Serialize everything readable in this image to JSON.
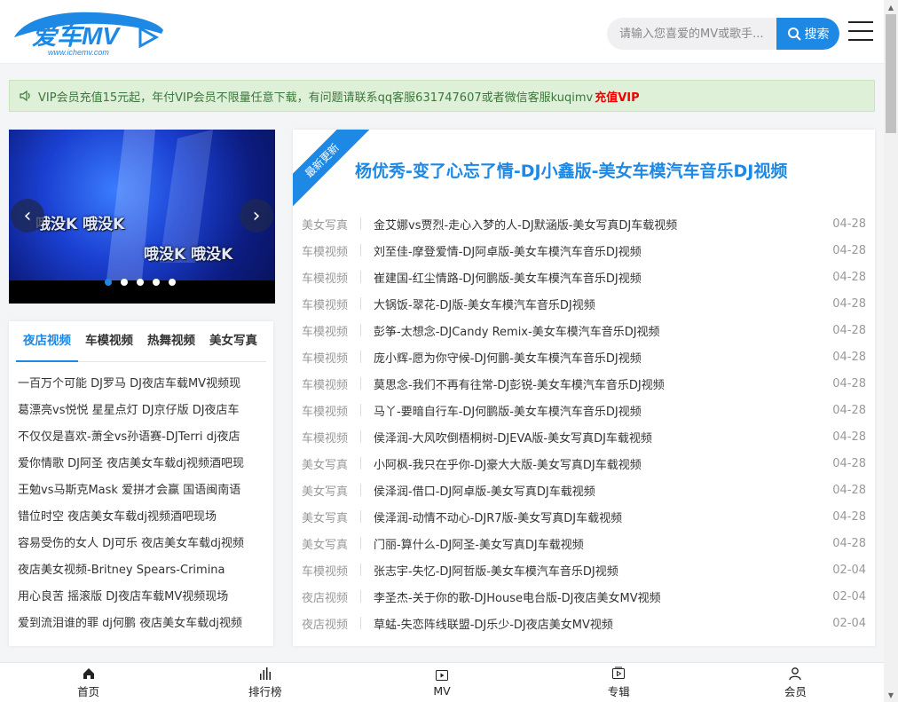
{
  "header": {
    "logo_text": "爱车MV",
    "logo_domain": "www.ichemv.com",
    "search_placeholder": "请输入您喜爱的MV或歌手...",
    "search_button": "搜索"
  },
  "notice": {
    "text": "VIP会员充值15元起，年付VIP会员不限量任意下载，有问题请联系qq客服631747607或者微信客服kuqimv",
    "link": "充值VIP"
  },
  "carousel": {
    "caption_1": "哦没K 哦没K",
    "caption_2": "哦没K 哦没K",
    "prev": "‹",
    "next": "›",
    "slide_count": 5,
    "active_slide": 1
  },
  "left_panel": {
    "tabs": [
      {
        "label": "夜店视频",
        "active": true
      },
      {
        "label": "车模视频",
        "active": false
      },
      {
        "label": "热舞视频",
        "active": false
      },
      {
        "label": "美女写真",
        "active": false
      }
    ],
    "items": [
      "一百万个可能 DJ罗马 DJ夜店车载MV视频现",
      "葛漂亮vs悦悦 星星点灯 DJ京仔版 DJ夜店车",
      "不仅仅是喜欢-萧全vs孙语赛-DJTerri dj夜店",
      "爱你情歌 DJ阿圣 夜店美女车载dj视频酒吧现",
      "王勉vs马斯克Mask 爱拼才会赢 国语闽南语",
      "错位时空 夜店美女车载dj视频酒吧现场",
      "容易受伤的女人 DJ可乐 夜店美女车载dj视频",
      "夜店美女视频-Britney Spears-Crimina",
      "用心良苦 摇滚版 DJ夜店车载MV视频现场",
      "爱到流泪谁的罪 dj何鹏 夜店美女车载dj视频"
    ]
  },
  "right_panel": {
    "ribbon": "最新更新",
    "featured_title": "杨优秀-变了心忘了情-DJ小鑫版-美女车模汽车音乐DJ视频",
    "rows": [
      {
        "cat": "美女写真",
        "title": "金艾娜vs贾烈-走心入梦的人-DJ默涵版-美女写真DJ车载视频",
        "date": "04-28"
      },
      {
        "cat": "车模视频",
        "title": "刘至佳-摩登爱情-DJ阿卓版-美女车模汽车音乐DJ视频",
        "date": "04-28"
      },
      {
        "cat": "车模视频",
        "title": "崔建国-红尘情路-DJ何鹏版-美女车模汽车音乐DJ视频",
        "date": "04-28"
      },
      {
        "cat": "车模视频",
        "title": "大锅饭-翠花-DJ版-美女车模汽车音乐DJ视频",
        "date": "04-28"
      },
      {
        "cat": "车模视频",
        "title": "彭筝-太想念-DJCandy Remix-美女车模汽车音乐DJ视频",
        "date": "04-28"
      },
      {
        "cat": "车模视频",
        "title": "庞小辉-愿为你守候-DJ何鹏-美女车模汽车音乐DJ视频",
        "date": "04-28"
      },
      {
        "cat": "车模视频",
        "title": "莫思念-我们不再有往常-DJ彭锐-美女车模汽车音乐DJ视频",
        "date": "04-28"
      },
      {
        "cat": "车模视频",
        "title": "马丫-要暗自行车-DJ何鹏版-美女车模汽车音乐DJ视频",
        "date": "04-28"
      },
      {
        "cat": "车模视频",
        "title": "侯泽润-大风吹倒梧桐树-DJEVA版-美女写真DJ车载视频",
        "date": "04-28"
      },
      {
        "cat": "美女写真",
        "title": "小阿枫-我只在乎你-DJ豪大大版-美女写真DJ车载视频",
        "date": "04-28"
      },
      {
        "cat": "美女写真",
        "title": "侯泽润-借口-DJ阿卓版-美女写真DJ车载视频",
        "date": "04-28"
      },
      {
        "cat": "美女写真",
        "title": "侯泽润-动情不动心-DJR7版-美女写真DJ车载视频",
        "date": "04-28"
      },
      {
        "cat": "美女写真",
        "title": "门丽-算什么-DJ阿圣-美女写真DJ车载视频",
        "date": "04-28"
      },
      {
        "cat": "车模视频",
        "title": "张志宇-失忆-DJ阿哲版-美女车模汽车音乐DJ视频",
        "date": "02-04"
      },
      {
        "cat": "夜店视频",
        "title": "李圣杰-关于你的歌-DJHouse电台版-DJ夜店美女MV视频",
        "date": "02-04"
      },
      {
        "cat": "夜店视频",
        "title": "草蜢-失恋阵线联盟-DJ乐少-DJ夜店美女MV视频",
        "date": "02-04"
      }
    ]
  },
  "bottom_nav": [
    {
      "label": "首页",
      "icon": "home-icon"
    },
    {
      "label": "排行榜",
      "icon": "chart-icon"
    },
    {
      "label": "MV",
      "icon": "play-icon"
    },
    {
      "label": "专辑",
      "icon": "album-icon"
    },
    {
      "label": "会员",
      "icon": "user-icon"
    }
  ],
  "colors": {
    "accent": "#1e88e5",
    "notice_bg": "#dff0d8",
    "notice_text": "#3c763d",
    "vip_red": "#e00000"
  }
}
